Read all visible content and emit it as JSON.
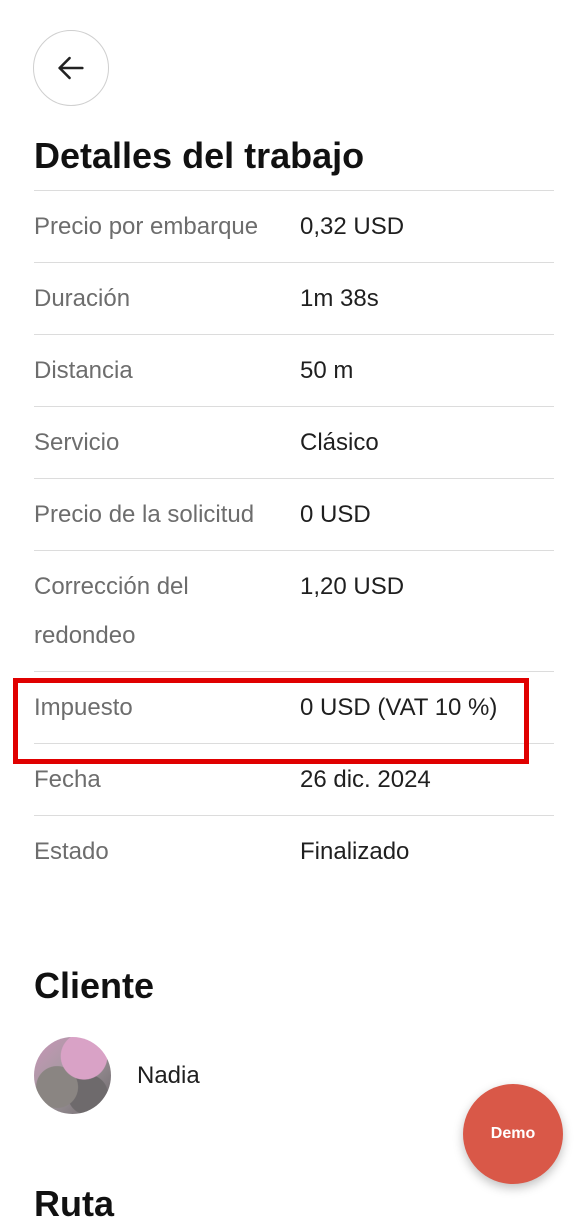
{
  "header": {
    "back_icon": "arrow-left-icon"
  },
  "details": {
    "title": "Detalles del trabajo",
    "rows": [
      {
        "label": "Precio por embarque",
        "value": "0,32 USD"
      },
      {
        "label": "Duración",
        "value": "1m 38s"
      },
      {
        "label": "Distancia",
        "value": "50 m"
      },
      {
        "label": "Servicio",
        "value": "Clásico"
      },
      {
        "label": "Precio de la solicitud",
        "value": "0 USD"
      },
      {
        "label": "Corrección del redondeo",
        "value": "1,20 USD"
      },
      {
        "label": "Impuesto",
        "value": "0 USD (VAT 10 %)"
      },
      {
        "label": "Fecha",
        "value": "26 dic. 2024"
      },
      {
        "label": "Estado",
        "value": "Finalizado"
      }
    ]
  },
  "client": {
    "title": "Cliente",
    "name": "Nadia"
  },
  "route": {
    "title": "Ruta"
  },
  "demo_button": {
    "label": "Demo",
    "color": "#d95848"
  },
  "highlight_color": "#e00000"
}
